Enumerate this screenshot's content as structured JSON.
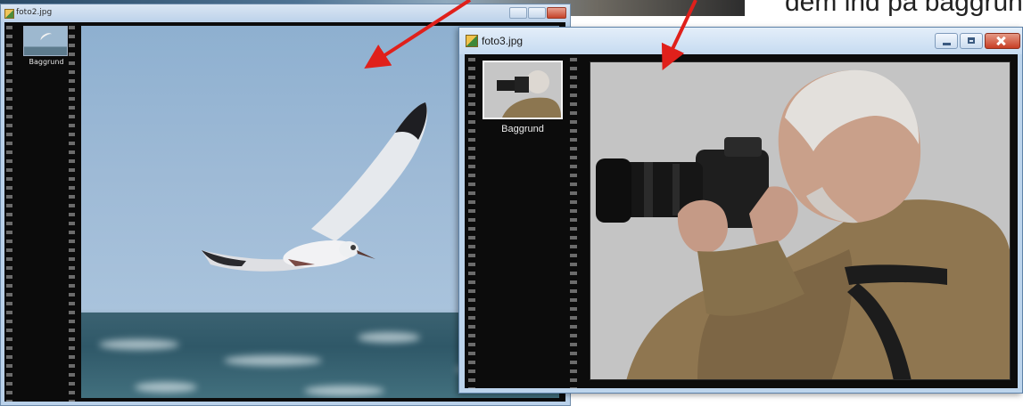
{
  "doc_text": {
    "partial_line": "dem ind på baggrund"
  },
  "window_foto2": {
    "title": "foto2.jpg",
    "layer_label": "Baggrund"
  },
  "window_foto3": {
    "title": "foto3.jpg",
    "layer_label": "Baggrund"
  },
  "colors": {
    "arrow": "#e0201b",
    "title_bar": "#c6dbf1"
  }
}
